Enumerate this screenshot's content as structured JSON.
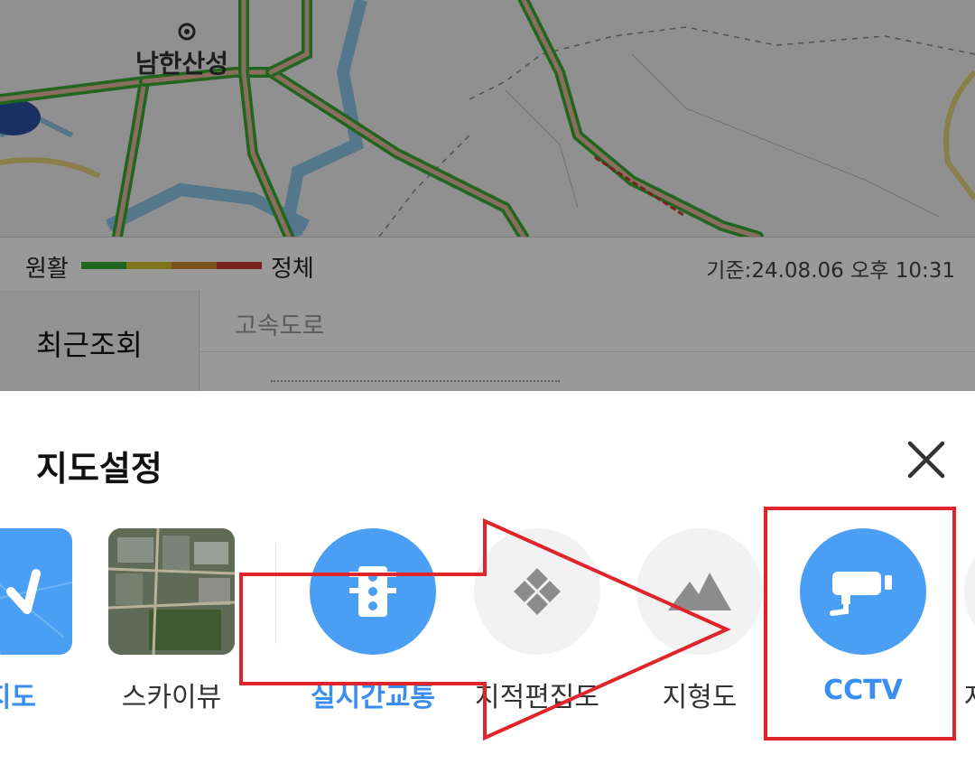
{
  "legend": {
    "smooth_label": "원활",
    "congested_label": "정체",
    "timestamp": "기준:24.08.06 오후 10:31",
    "colors": [
      "#3aa832",
      "#d6c12c",
      "#d08a2a",
      "#c63b2c"
    ]
  },
  "list_panel": {
    "recent_tab": "최근조회",
    "category": "고속도로"
  },
  "map_labels": {
    "town": "남한산성"
  },
  "sheet": {
    "title": "지도설정",
    "options": [
      {
        "label": "지도",
        "active": true,
        "icon": "map-icon"
      },
      {
        "label": "스카이뷰",
        "active": false,
        "icon": "skyview-thumbnail"
      },
      {
        "label": "실시간교통",
        "active": true,
        "icon": "traffic-light-icon"
      },
      {
        "label": "지적편집도",
        "active": false,
        "icon": "cadastral-icon"
      },
      {
        "label": "지형도",
        "active": false,
        "icon": "terrain-icon"
      },
      {
        "label": "CCTV",
        "active": true,
        "icon": "cctv-camera-icon"
      },
      {
        "label": "자",
        "active": false,
        "icon": "partial-option-icon"
      }
    ]
  },
  "colors": {
    "accent": "#4a9ff5",
    "active_text": "#3a8ef0",
    "annotation_red": "#e0242b"
  }
}
